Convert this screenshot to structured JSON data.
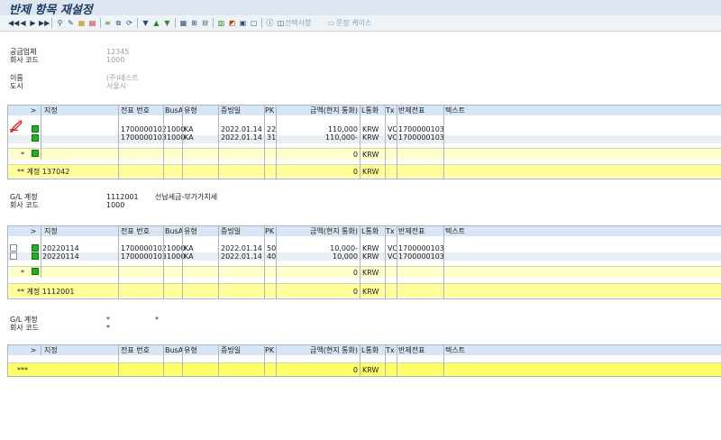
{
  "window": {
    "title": "반제 항목 재설정"
  },
  "toolbar": {
    "nav": [
      "◀◀",
      "◀",
      "▶",
      "▶▶"
    ],
    "icons": [
      "glasses-icon",
      "pencil-icon",
      "layout-icon",
      "grid-icon",
      "stack-icon",
      "copy-icon",
      "refresh-icon",
      "filter-icon",
      "sort-asc-icon",
      "sort-desc-icon",
      "table-icon",
      "table-add-icon",
      "table-remove-icon",
      "chart-icon",
      "color-icon",
      "doc-icon",
      "doc2-icon",
      "info-icon"
    ],
    "selection_label": "선택사항",
    "document_label": "문장 케이스"
  },
  "header": {
    "vendor_label": "공급업체",
    "company_label": "회사 코드",
    "vendor_value": "12345",
    "company_value": "1000",
    "name_label": "이름",
    "city_label": "도시",
    "name_value": "(주)테스트",
    "city_value": "서울시"
  },
  "columns": [
    ">",
    "지정",
    "전표 번호",
    "BusA",
    "유형",
    "증빙일",
    "PK",
    "금액(현지 통화)",
    "L통화",
    "Tx",
    "반제전표",
    "텍스트"
  ],
  "table1": {
    "rows": [
      {
        "assign": "",
        "doc": "1700000102",
        "busa": "1000",
        "type": "KA",
        "date": "2022.01.14",
        "pk": "22",
        "amount": "110,000",
        "cur": "KRW",
        "tx": "VO",
        "clear": "1700000103"
      },
      {
        "assign": "",
        "doc": "1700000103",
        "busa": "1000",
        "type": "KA",
        "date": "2022.01.14",
        "pk": "31",
        "amount": "110,000-",
        "cur": "KRW",
        "tx": "VO",
        "clear": "1700000103"
      }
    ],
    "subtotal": {
      "marker": "*",
      "amount": "0",
      "cur": "KRW"
    },
    "total": {
      "label": "** 계정 137042",
      "amount": "0",
      "cur": "KRW"
    }
  },
  "gl1": {
    "gl_label": "G/L 계정",
    "company_label": "회사 코드",
    "gl_value": "1112001",
    "gl_desc": "선납세금-부가가치세",
    "company_value": "1000"
  },
  "table2": {
    "rows": [
      {
        "assign": "20220114",
        "doc": "1700000102",
        "busa": "1000",
        "type": "KA",
        "date": "2022.01.14",
        "pk": "50",
        "amount": "10,000-",
        "cur": "KRW",
        "tx": "VO",
        "clear": "1700000103"
      },
      {
        "assign": "20220114",
        "doc": "1700000103",
        "busa": "1000",
        "type": "KA",
        "date": "2022.01.14",
        "pk": "40",
        "amount": "10,000",
        "cur": "KRW",
        "tx": "VO",
        "clear": "1700000103"
      }
    ],
    "subtotal": {
      "marker": "*",
      "amount": "0",
      "cur": "KRW"
    },
    "total": {
      "label": "** 계정 1112001",
      "amount": "0",
      "cur": "KRW"
    }
  },
  "gl2": {
    "gl_label": "G/L 계정",
    "company_label": "회사 코드",
    "gl_value": "*",
    "gl_desc": "*",
    "company_value": "*"
  },
  "table3": {
    "total": {
      "label": "***",
      "amount": "0",
      "cur": "KRW"
    }
  }
}
